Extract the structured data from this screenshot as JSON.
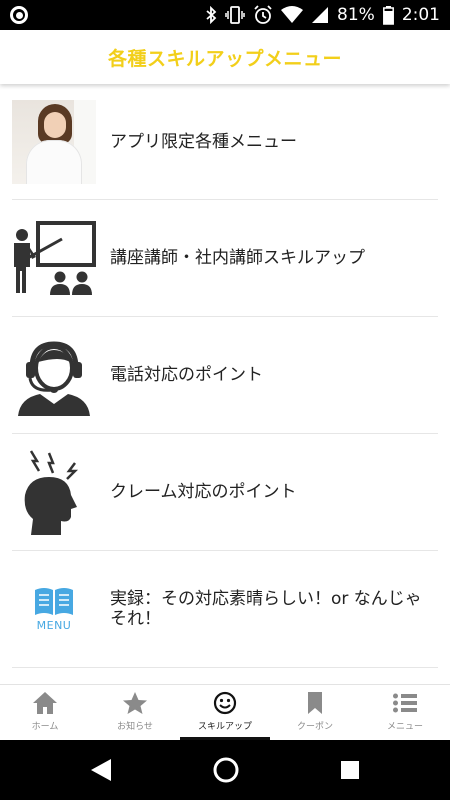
{
  "status_bar": {
    "battery_percent": "81%",
    "time": "2:01",
    "icons": [
      "circle-notification-icon",
      "bluetooth-icon",
      "vibrate-icon",
      "alarm-icon",
      "wifi-icon",
      "cell-signal-icon",
      "battery-icon"
    ]
  },
  "header": {
    "title": "各種スキルアップメニュー",
    "title_color": "#f2cf1a"
  },
  "list": {
    "items": [
      {
        "label": "アプリ限定各種メニュー",
        "icon": "woman-photo"
      },
      {
        "label": "講座講師・社内講師スキルアップ",
        "icon": "lecturer-icon"
      },
      {
        "label": "電話対応のポイント",
        "icon": "headset-operator-icon"
      },
      {
        "label": "クレーム対応のポイント",
        "icon": "frustrated-head-icon"
      },
      {
        "label": "実録：その対応素晴らしい！or なんじゃそれ！",
        "icon": "menu-book-icon",
        "icon_text": "MENU",
        "icon_color": "#47a8e2"
      }
    ]
  },
  "tabbar": {
    "active_index": 2,
    "tabs": [
      {
        "label": "ホーム",
        "icon": "home-icon"
      },
      {
        "label": "お知らせ",
        "icon": "star-icon"
      },
      {
        "label": "スキルアップ",
        "icon": "smiley-icon"
      },
      {
        "label": "クーポン",
        "icon": "bookmark-icon"
      },
      {
        "label": "メニュー",
        "icon": "list-icon"
      }
    ]
  },
  "navbar": {
    "buttons": [
      "back-icon",
      "home-circle-icon",
      "recents-icon"
    ]
  }
}
